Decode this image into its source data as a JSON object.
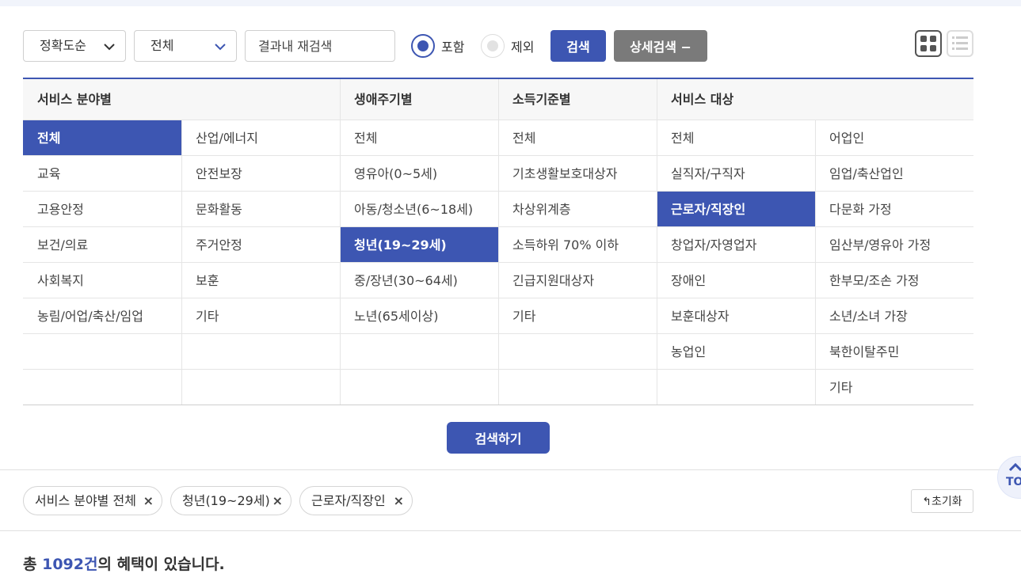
{
  "search": {
    "sort_value": "정확도순",
    "scope_value": "전체",
    "re_search_placeholder": "결과내 재검색",
    "include_label": "포함",
    "exclude_label": "제외",
    "search_button": "검색",
    "advanced_button": "상세검색 −"
  },
  "filter": {
    "headers": {
      "field": "서비스 분야별",
      "lifecycle": "생애주기별",
      "income": "소득기준별",
      "target": "서비스 대상"
    },
    "field_col1": [
      "전체",
      "교육",
      "고용안정",
      "보건/의료",
      "사회복지",
      "농림/어업/축산/임업"
    ],
    "field_col2": [
      "산업/에너지",
      "안전보장",
      "문화활동",
      "주거안정",
      "보훈",
      "기타"
    ],
    "lifecycle": [
      "전체",
      "영유아(0~5세)",
      "아동/청소년(6~18세)",
      "청년(19~29세)",
      "중/장년(30~64세)",
      "노년(65세이상)"
    ],
    "income": [
      "전체",
      "기초생활보호대상자",
      "차상위계층",
      "소득하위 70% 이하",
      "긴급지원대상자",
      "기타"
    ],
    "target_col1": [
      "전체",
      "실직자/구직자",
      "근로자/직장인",
      "창업자/자영업자",
      "장애인",
      "보훈대상자",
      "농업인"
    ],
    "target_col2": [
      "어업인",
      "임업/축산업인",
      "다문화 가정",
      "임산부/영유아 가정",
      "한부모/조손 가정",
      "소년/소녀 가장",
      "북한이탈주민",
      "기타"
    ]
  },
  "go_button": "검색하기",
  "chips": [
    "서비스 분야별 전체",
    "청년(19~29세)",
    "근로자/직장인"
  ],
  "chip_remove_symbol": "×",
  "reset_label": "초기화",
  "result": {
    "prefix": "총 ",
    "count": "1092건",
    "suffix": "의 혜택이 있습니다."
  },
  "top_label": "TOP",
  "colors": {
    "accent": "#3d56b2",
    "secondary_button": "#7a7a7a"
  }
}
